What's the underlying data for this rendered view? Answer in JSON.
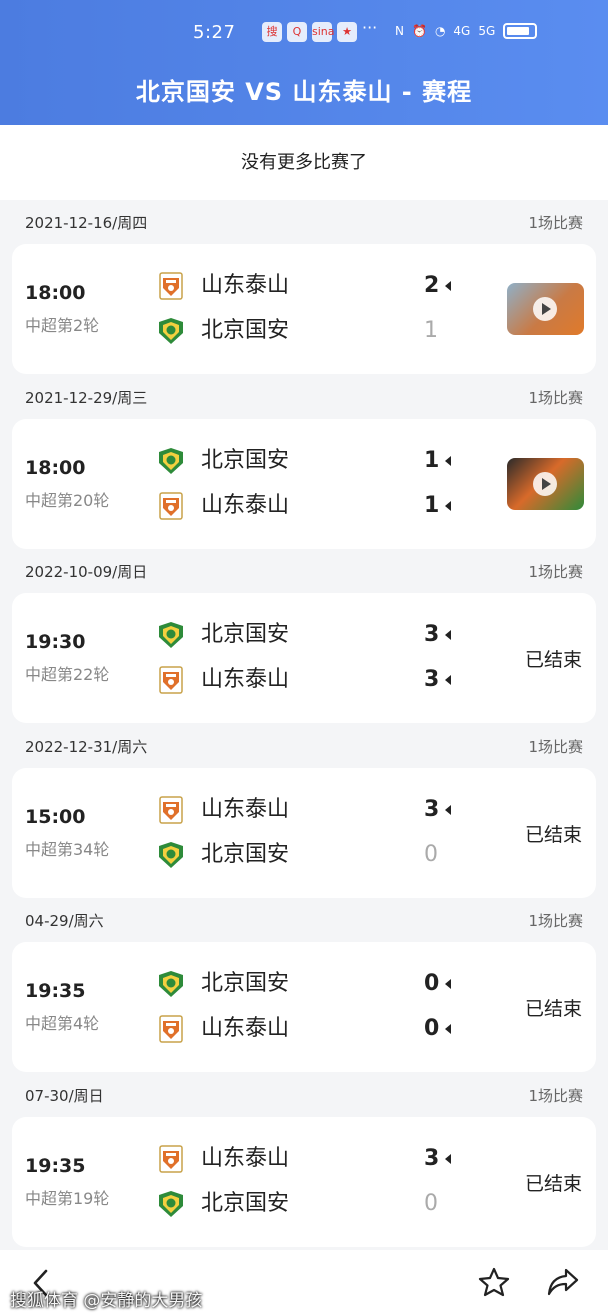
{
  "status_bar": {
    "time": "5:27",
    "app_icons": [
      "搜",
      "Q",
      "sina",
      "★"
    ],
    "more": "···",
    "network_left": "4G",
    "network_right": "5G"
  },
  "header": {
    "title": "北京国安 VS 山东泰山 - 赛程"
  },
  "no_more_text": "没有更多比赛了",
  "matches": [
    {
      "date": "2021-12-16/周四",
      "count": "1场比赛",
      "time": "18:00",
      "round": "中超第2轮",
      "home": {
        "name": "山东泰山",
        "crest": "taishan",
        "score": "2",
        "win": true
      },
      "away": {
        "name": "北京国安",
        "crest": "guoan",
        "score": "1",
        "win": false
      },
      "status": "",
      "video": true
    },
    {
      "date": "2021-12-29/周三",
      "count": "1场比赛",
      "time": "18:00",
      "round": "中超第20轮",
      "home": {
        "name": "北京国安",
        "crest": "guoan",
        "score": "1",
        "win": true
      },
      "away": {
        "name": "山东泰山",
        "crest": "taishan",
        "score": "1",
        "win": true
      },
      "status": "",
      "video": true
    },
    {
      "date": "2022-10-09/周日",
      "count": "1场比赛",
      "time": "19:30",
      "round": "中超第22轮",
      "home": {
        "name": "北京国安",
        "crest": "guoan",
        "score": "3",
        "win": true
      },
      "away": {
        "name": "山东泰山",
        "crest": "taishan",
        "score": "3",
        "win": true
      },
      "status": "已结束",
      "video": false
    },
    {
      "date": "2022-12-31/周六",
      "count": "1场比赛",
      "time": "15:00",
      "round": "中超第34轮",
      "home": {
        "name": "山东泰山",
        "crest": "taishan",
        "score": "3",
        "win": true
      },
      "away": {
        "name": "北京国安",
        "crest": "guoan",
        "score": "0",
        "win": false
      },
      "status": "已结束",
      "video": false
    },
    {
      "date": "04-29/周六",
      "count": "1场比赛",
      "time": "19:35",
      "round": "中超第4轮",
      "home": {
        "name": "北京国安",
        "crest": "guoan",
        "score": "0",
        "win": true
      },
      "away": {
        "name": "山东泰山",
        "crest": "taishan",
        "score": "0",
        "win": true
      },
      "status": "已结束",
      "video": false
    },
    {
      "date": "07-30/周日",
      "count": "1场比赛",
      "time": "19:35",
      "round": "中超第19轮",
      "home": {
        "name": "山东泰山",
        "crest": "taishan",
        "score": "3",
        "win": true
      },
      "away": {
        "name": "北京国安",
        "crest": "guoan",
        "score": "0",
        "win": false
      },
      "status": "已结束",
      "video": false
    }
  ],
  "watermark": "搜狐体育 @安静的大男孩",
  "colors": {
    "header": "#4c7ce0",
    "guoan": "#2e8b3a",
    "taishan": "#e0702a"
  },
  "icons": {
    "back": "back-arrow-icon",
    "favorite": "star-icon",
    "share": "share-icon"
  }
}
